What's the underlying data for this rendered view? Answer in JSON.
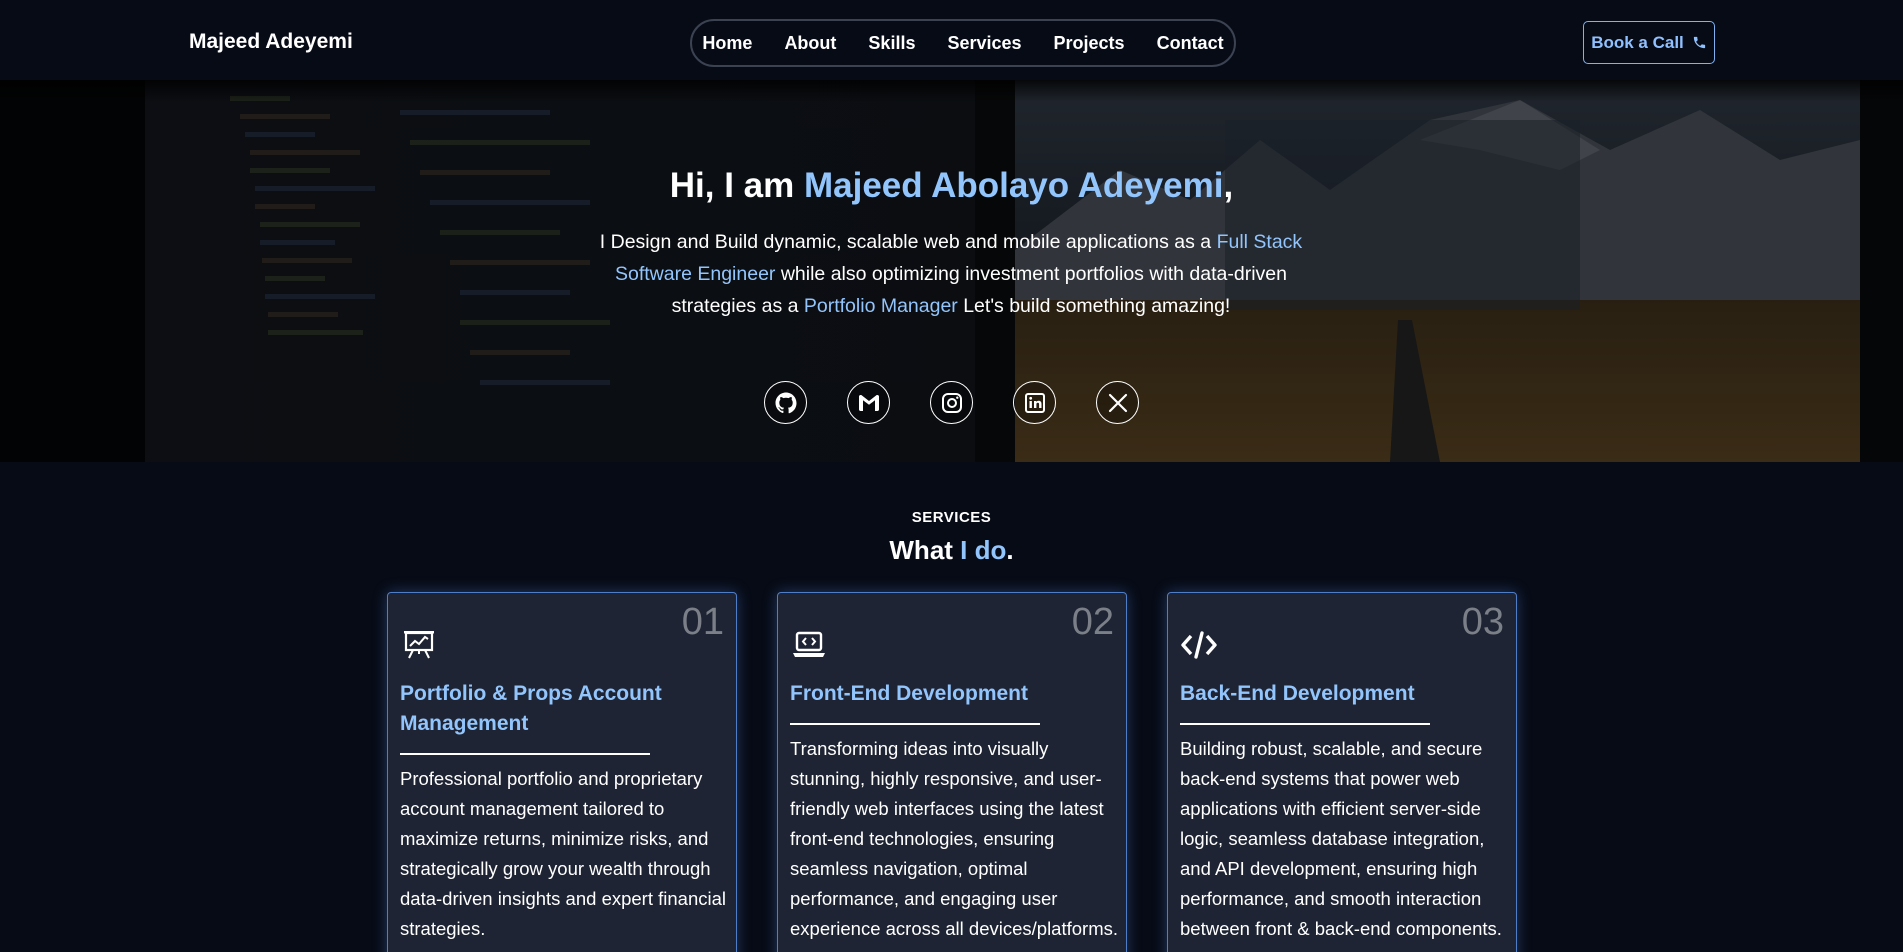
{
  "header": {
    "brand": "Majeed Adeyemi",
    "nav": [
      "Home",
      "About",
      "Skills",
      "Services",
      "Projects",
      "Contact"
    ],
    "cta_label": "Book a Call"
  },
  "hero": {
    "greeting": "Hi, I am ",
    "name": "Majeed Abolayo Adeyemi",
    "comma": ",",
    "desc_1": "I Design and Build dynamic, scalable web and mobile applications as a ",
    "role_1": "Full Stack Software Engineer",
    "desc_2": " while also optimizing investment portfolios with data-driven strategies as a ",
    "role_2": "Portfolio Manager",
    "desc_3": " Let's build something amazing!",
    "socials": [
      "github-icon",
      "gmail-icon",
      "instagram-icon",
      "linkedin-icon",
      "x-icon"
    ]
  },
  "services": {
    "eyebrow": "SERVICES",
    "title_a": "What ",
    "title_b": "I do",
    "title_c": ".",
    "cards": [
      {
        "num": "01",
        "icon": "presentation-chart-icon",
        "title": "Portfolio & Props Account Management",
        "body": "Professional portfolio and proprietary account management tailored to maximize returns, minimize risks, and strategically grow your wealth through data-driven insights and expert financial strategies."
      },
      {
        "num": "02",
        "icon": "laptop-code-icon",
        "title": "Front-End Development",
        "body": "Transforming ideas into visually stunning, highly responsive, and user-friendly web interfaces using the latest front-end technologies, ensuring seamless navigation, optimal performance, and engaging user experience across all devices/platforms."
      },
      {
        "num": "03",
        "icon": "code-brackets-icon",
        "title": "Back-End Development",
        "body": "Building robust, scalable, and secure back-end systems that power web applications with efficient server-side logic, seamless database integration, and API development, ensuring high performance, and smooth interaction between front & back-end components."
      }
    ]
  },
  "colors": {
    "background": "#070b16",
    "accent": "#93c5fd",
    "card_bg": "#1e2433",
    "card_border": "#4f7ec9"
  }
}
